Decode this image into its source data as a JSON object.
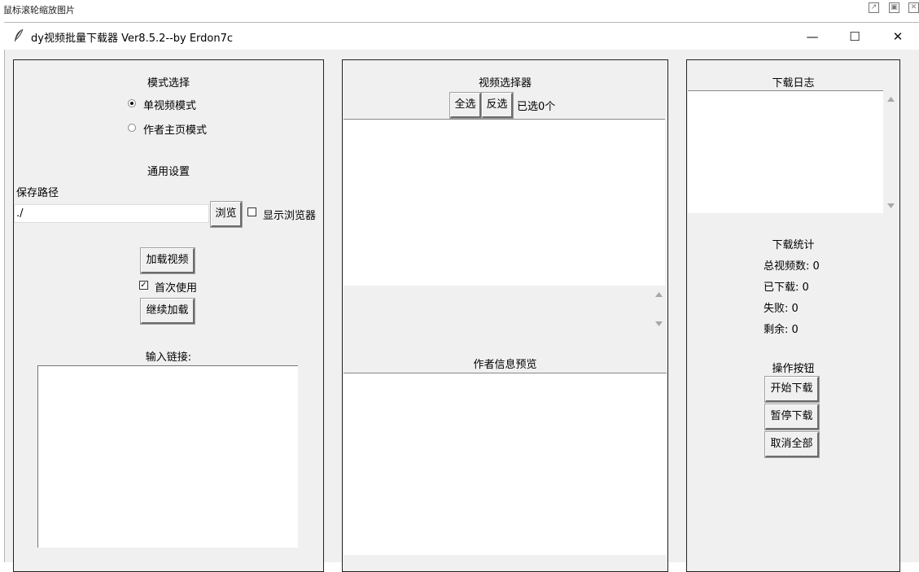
{
  "viewer": {
    "hint": "鼠标滚轮缩放图片"
  },
  "window": {
    "title": "dy视频批量下载器 Ver8.5.2--by Erdon7c",
    "minimize": "—",
    "maximize": "☐",
    "close": "✕"
  },
  "left_panel": {
    "mode_heading": "模式选择",
    "mode_options": [
      {
        "label": "单视频模式",
        "selected": true
      },
      {
        "label": "作者主页模式",
        "selected": false
      }
    ],
    "settings_heading": "通用设置",
    "save_path_label": "保存路径",
    "save_path_value": "./",
    "browse_label": "浏览",
    "show_browser_label": "显示浏览器",
    "show_browser_checked": false,
    "load_video_label": "加载视频",
    "first_use_label": "首次使用",
    "first_use_checked": true,
    "continue_load_label": "继续加载",
    "input_link_label": "输入链接:",
    "input_link_value": ""
  },
  "middle_panel": {
    "heading": "视频选择器",
    "select_all_label": "全选",
    "invert_label": "反选",
    "selected_count_text": "已选0个",
    "author_preview_heading": "作者信息预览"
  },
  "right_panel": {
    "log_heading": "下载日志",
    "stats_heading": "下载统计",
    "stats": [
      "总视频数: 0",
      "已下载: 0",
      "失败: 0",
      "剩余: 0"
    ],
    "actions_heading": "操作按钮",
    "start_label": "开始下载",
    "pause_label": "暂停下载",
    "cancel_label": "取消全部"
  }
}
